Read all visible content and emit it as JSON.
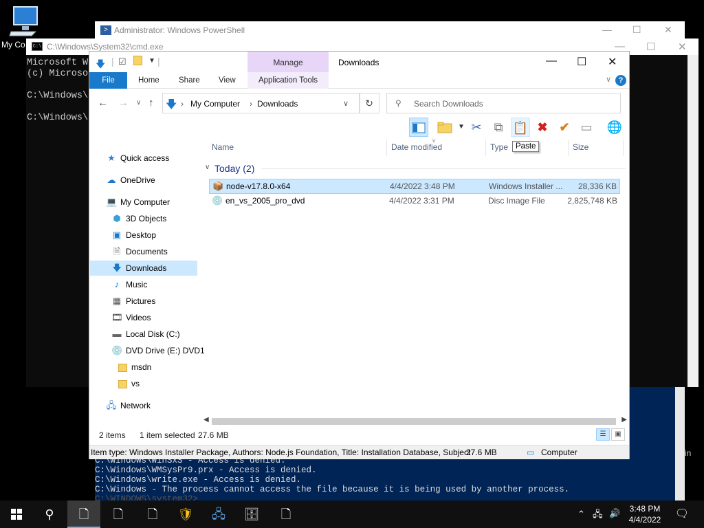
{
  "desktop": {
    "icon_label": "My Co"
  },
  "powershell": {
    "title": "Administrator: Windows PowerShell",
    "lines": [
      "C:\\Windows\\WinSxS - Access is denied.",
      "C:\\Windows\\WMSysPr9.prx - Access is denied.",
      "C:\\Windows\\write.exe - Access is denied.",
      "C:\\Windows - The process cannot access the file because it is being used by another process."
    ],
    "partial_line": "C:\\WINDOWS\\system32>",
    "side_text": "in"
  },
  "cmd": {
    "title": "C:\\Windows\\System32\\cmd.exe",
    "icon_text": "C:\\",
    "lines": [
      "Microsoft W",
      "(c) Microso",
      "",
      "C:\\Windows\\s",
      "",
      "C:\\Windows\\s"
    ]
  },
  "explorer": {
    "title": "Downloads",
    "manage_tab": "Manage",
    "tabs": {
      "file": "File",
      "home": "Home",
      "share": "Share",
      "view": "View",
      "app_tools": "Application Tools"
    },
    "address": {
      "root": "My Computer",
      "current": "Downloads"
    },
    "search": {
      "placeholder": "Search Downloads"
    },
    "tooltip": "Paste",
    "nav": {
      "quick_access": "Quick access",
      "onedrive": "OneDrive",
      "my_computer": "My Computer",
      "objects3d": "3D Objects",
      "desktop": "Desktop",
      "documents": "Documents",
      "downloads": "Downloads",
      "music": "Music",
      "pictures": "Pictures",
      "videos": "Videos",
      "local_disk": "Local Disk (C:)",
      "dvd_drive": "DVD Drive (E:) DVD1",
      "msdn": "msdn",
      "vs": "vs",
      "network": "Network"
    },
    "columns": {
      "name": "Name",
      "date": "Date modified",
      "type": "Type",
      "size": "Size"
    },
    "group": {
      "label": "Today (2)"
    },
    "files": [
      {
        "name": "node-v17.8.0-x64",
        "date": "4/4/2022 3:48 PM",
        "type": "Windows Installer ...",
        "size": "28,336 KB"
      },
      {
        "name": "en_vs_2005_pro_dvd",
        "date": "4/4/2022 3:31 PM",
        "type": "Disc Image File",
        "size": "2,825,748 KB"
      }
    ],
    "status": {
      "count": "2 items",
      "selected": "1 item selected",
      "sel_size": "27.6 MB"
    },
    "infobar": {
      "details": "Item type: Windows Installer Package, Authors: Node.js Foundation, Title: Installation Database, Subject",
      "size": "27.6 MB",
      "location": "Computer"
    }
  },
  "taskbar": {
    "time": "3:48 PM",
    "date": "4/4/2022"
  },
  "colors": {
    "accent": "#1979ca",
    "selection": "#cce8ff",
    "powershell_bg": "#012456",
    "manage_tab": "#e8d6f8"
  }
}
